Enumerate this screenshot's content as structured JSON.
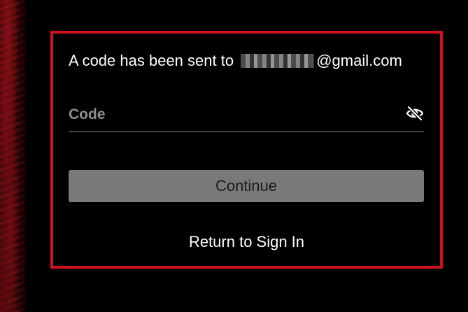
{
  "verification": {
    "message_prefix": "A code has been sent to",
    "email_domain": "@gmail.com",
    "code_placeholder": "Code",
    "code_value": "",
    "visibility_icon": "eye-slash-icon",
    "continue_label": "Continue",
    "return_label": "Return to Sign In"
  },
  "colors": {
    "accent_border": "#d0121b",
    "button_background": "#7a7a7a",
    "background": "#000000",
    "text": "#ffffff"
  }
}
